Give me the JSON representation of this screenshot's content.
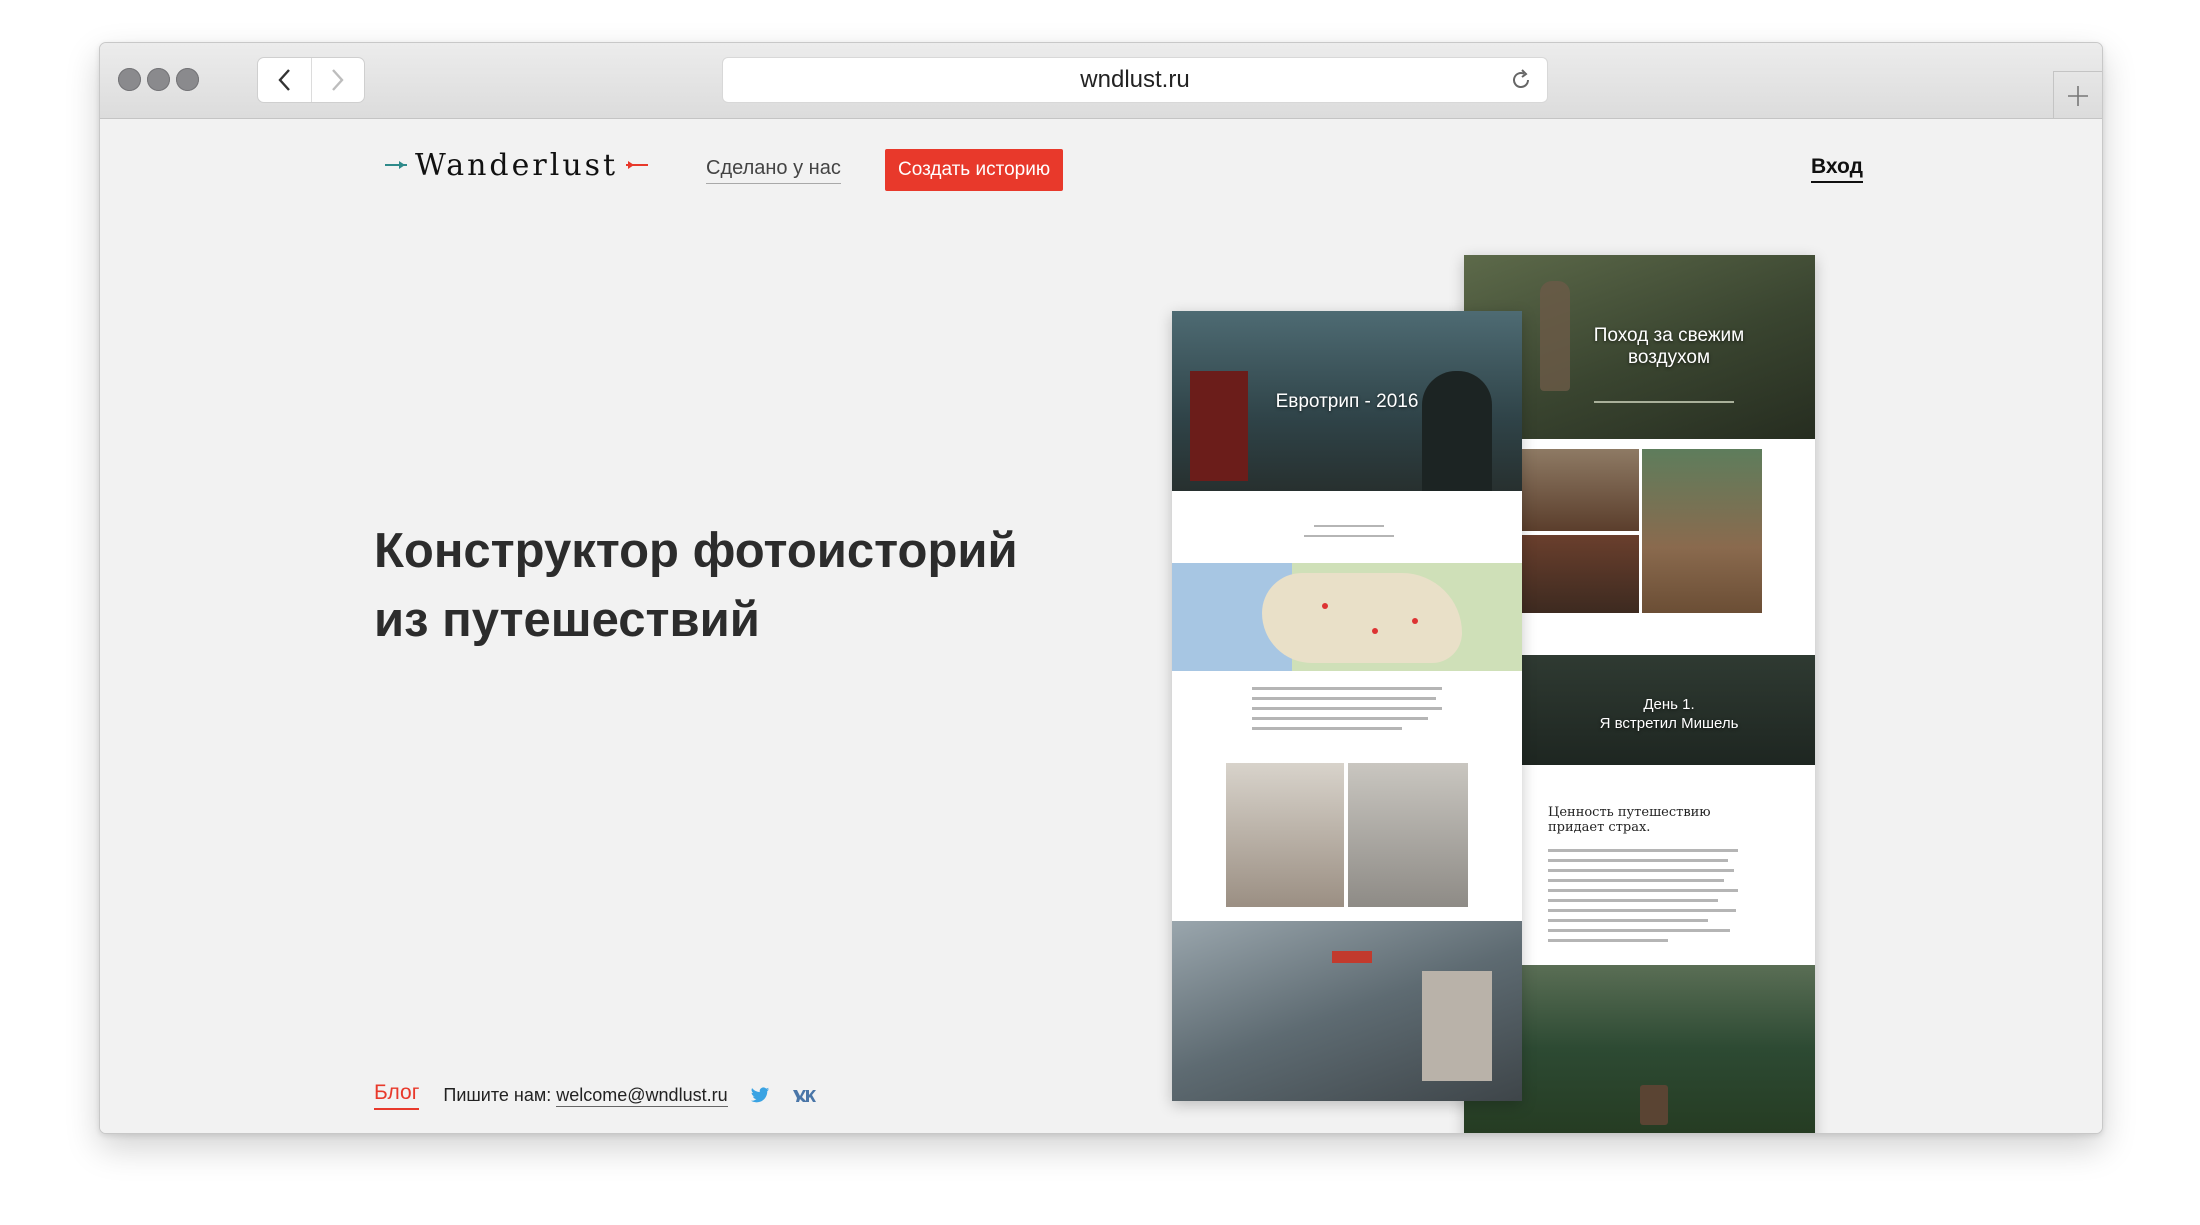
{
  "browser": {
    "url": "wndlust.ru"
  },
  "header": {
    "logo_text": "Wanderlust",
    "nav_made_here": "Сделано у нас",
    "create_story": "Создать историю",
    "login": "Вход"
  },
  "hero": {
    "line1": "Конструктор фотоисторий",
    "line2": "из путешествий"
  },
  "footer": {
    "blog": "Блог",
    "write_us_label": "Пишите нам:",
    "email": "welcome@wndlust.ru",
    "social_icons": [
      "twitter-icon",
      "vk-icon"
    ]
  },
  "previews": {
    "left": {
      "title": "Евротрип - 2016"
    },
    "right": {
      "title": "Поход за свежим воздухом",
      "day_caption_1": "День 1.",
      "day_caption_2": "Я встретил Мишель",
      "article_heading": "Ценность путешествию придает страх."
    }
  },
  "colors": {
    "accent": "#e8392b",
    "page_bg": "#f2f2f2",
    "text": "#2c2c2c"
  }
}
